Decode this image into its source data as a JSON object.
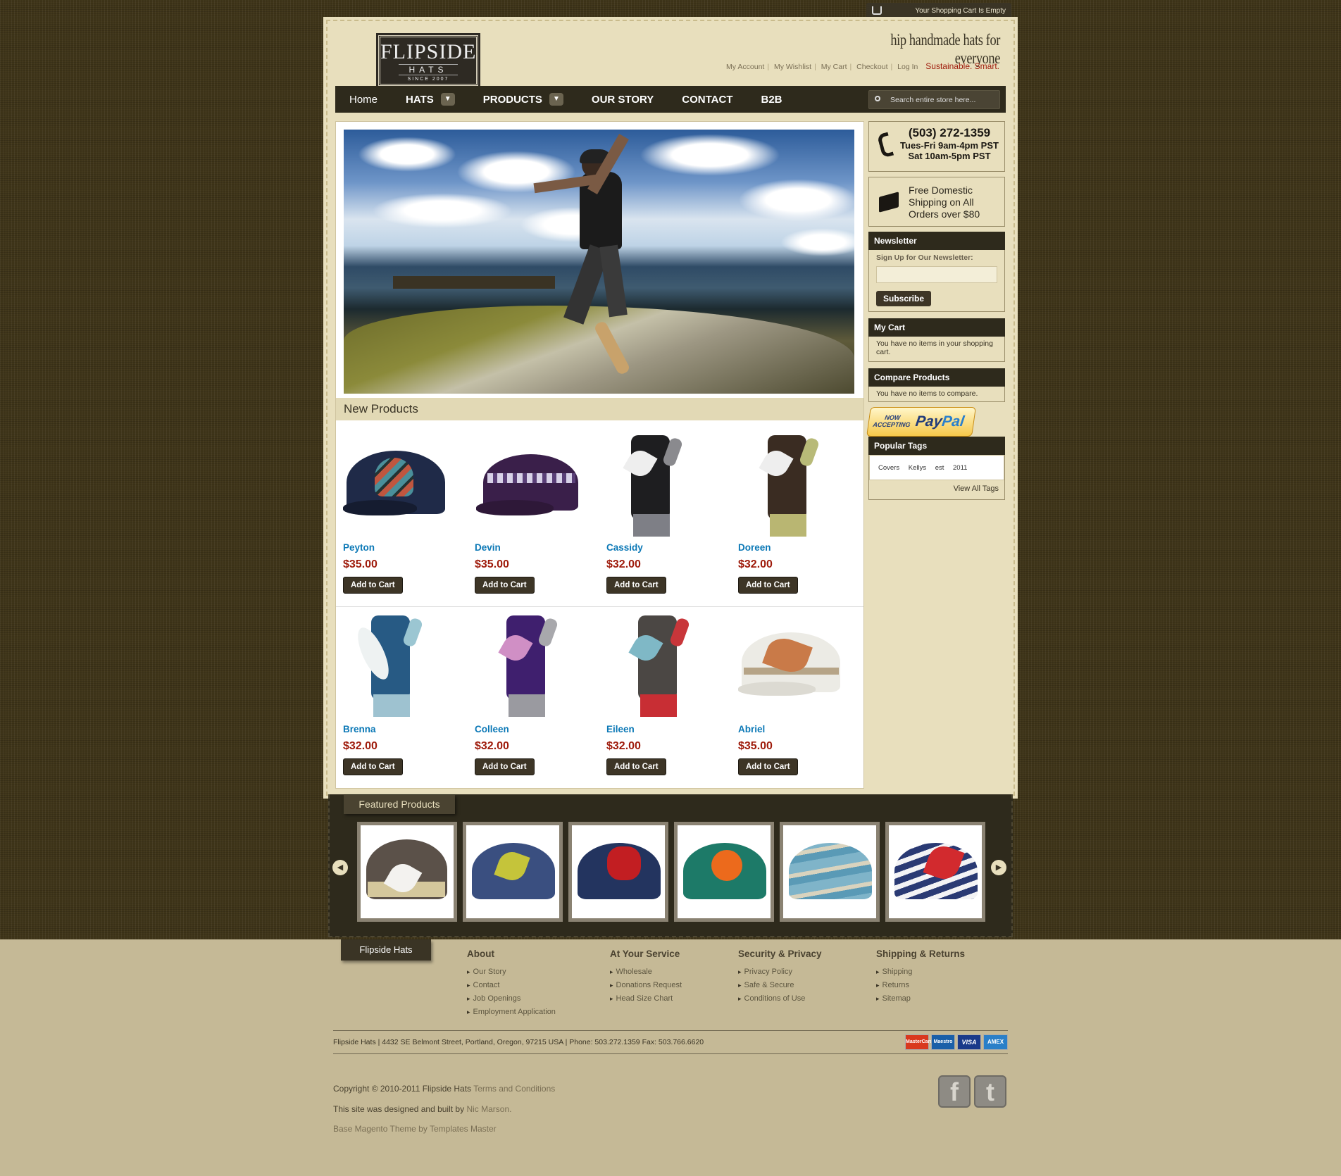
{
  "cart_bar": {
    "text": "Your Shopping Cart Is Empty"
  },
  "header": {
    "logo_main": "FLIPSIDE",
    "logo_sub": "HATS",
    "logo_since": "SINCE 2007",
    "tagline": "hip handmade hats for everyone",
    "links": [
      "My Account",
      "My Wishlist",
      "My Cart",
      "Checkout",
      "Log In"
    ],
    "slogan": "Sustainable. Smart."
  },
  "nav": {
    "items": [
      "Home",
      "HATS",
      "PRODUCTS",
      "OUR STORY",
      "CONTACT",
      "B2B"
    ],
    "dropdown_icon": "▼"
  },
  "search": {
    "placeholder": "Search entire store here..."
  },
  "new_products": {
    "heading": "New Products",
    "add_label": "Add to Cart",
    "items": [
      {
        "name": "Peyton",
        "price": "$35.00"
      },
      {
        "name": "Devin",
        "price": "$35.00"
      },
      {
        "name": "Cassidy",
        "price": "$32.00"
      },
      {
        "name": "Doreen",
        "price": "$32.00"
      },
      {
        "name": "Brenna",
        "price": "$32.00"
      },
      {
        "name": "Colleen",
        "price": "$32.00"
      },
      {
        "name": "Eileen",
        "price": "$32.00"
      },
      {
        "name": "Abriel",
        "price": "$35.00"
      }
    ]
  },
  "sidebar": {
    "phone": {
      "number": "(503) 272-1359",
      "hours1": "Tues-Fri 9am-4pm PST",
      "hours2": "Sat 10am-5pm PST"
    },
    "shipping": {
      "line1": "Free Domestic",
      "line2": "Shipping on All",
      "line3": "Orders over $80"
    },
    "newsletter": {
      "title": "Newsletter",
      "label": "Sign Up for Our Newsletter:",
      "button": "Subscribe"
    },
    "cart": {
      "title": "My Cart",
      "text": "You have no items in your shopping cart."
    },
    "compare": {
      "title": "Compare Products",
      "text": "You have no items to compare."
    },
    "paypal": {
      "now": "NOW",
      "accepting": "ACCEPTING",
      "pay": "Pay",
      "pal": "Pal"
    },
    "tags": {
      "title": "Popular Tags",
      "items": "Covers Kellys est 2011",
      "view_all": "View All Tags"
    }
  },
  "featured": {
    "title": "Featured Products",
    "prev": "◀",
    "next": "▶"
  },
  "footer": {
    "tab": "Flipside Hats",
    "columns": [
      {
        "title": "About",
        "links": [
          "Our Story",
          "Contact",
          "Job Openings",
          "Employment Application"
        ]
      },
      {
        "title": "At Your Service",
        "links": [
          "Wholesale",
          "Donations Request",
          "Head Size Chart"
        ]
      },
      {
        "title": "Security & Privacy",
        "links": [
          "Privacy Policy",
          "Safe & Secure",
          "Conditions of Use"
        ]
      },
      {
        "title": "Shipping & Returns",
        "links": [
          "Shipping",
          "Returns",
          "Sitemap"
        ]
      }
    ],
    "address": "Flipside Hats | 4432 SE Belmont Street, Portland, Oregon, 97215 USA | Phone: 503.272.1359 Fax: 503.766.6620",
    "cards": [
      "MasterCard",
      "Maestro",
      "VISA",
      "AMEX"
    ],
    "copyright": "Copyright © 2010-2011 Flipside Hats",
    "terms": "Terms and Conditions",
    "designed": "This site was designed and built by",
    "designer": "Nic Marson.",
    "theme": "Base Magento Theme by Templates Master",
    "social": [
      "f",
      "t"
    ]
  }
}
